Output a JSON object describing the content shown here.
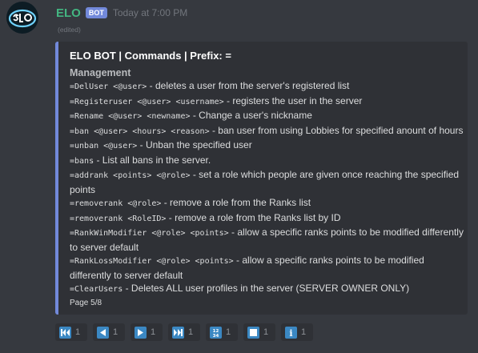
{
  "message": {
    "author": "ELO",
    "bot_tag": "BOT",
    "timestamp": "Today at 7:00 PM",
    "edited": "(edited)"
  },
  "embed": {
    "color": "#7289da",
    "title": "ELO BOT | Commands | Prefix: =",
    "field_name": "Management",
    "lines": [
      {
        "cmd": "=DelUser <@user>",
        "desc": " - deletes a user from the server's registered list"
      },
      {
        "cmd": "=Registeruser <@user> <username>",
        "desc": " - registers the user in the server"
      },
      {
        "cmd": "=Rename <@user> <newname>",
        "desc": " - Change a user's nickname"
      },
      {
        "cmd": "=ban <@user> <hours> <reason>",
        "desc": " - ban user from using Lobbies for specified anount of hours"
      },
      {
        "cmd": "=unban <@user>",
        "desc": " - Unban the specified user"
      },
      {
        "cmd": "=bans",
        "desc": " - List all bans in the server."
      },
      {
        "cmd": "=addrank <points> <@role>",
        "desc": " - set a role which people are given once reaching the specified points"
      },
      {
        "cmd": "=removerank <@role>",
        "desc": " - remove a role from the Ranks list"
      },
      {
        "cmd": "=removerank <RoleID>",
        "desc": " - remove a role from the Ranks list by ID"
      },
      {
        "cmd": "=RankWinModifier <@role> <points>",
        "desc": " - allow a specific ranks points to be modified differently to server default"
      },
      {
        "cmd": "=RankLossModifier <@role> <points>",
        "desc": " - allow a specific ranks points to be modified differently to server default"
      },
      {
        "cmd": "=ClearUsers",
        "desc": " - Deletes ALL user profiles in the server (SERVER OWNER ONLY)"
      }
    ],
    "footer": "Page 5/8"
  },
  "reactions": [
    {
      "icon": "track-previous-icon",
      "count": "1"
    },
    {
      "icon": "arrow-backward-icon",
      "count": "1"
    },
    {
      "icon": "arrow-forward-icon",
      "count": "1"
    },
    {
      "icon": "track-next-icon",
      "count": "1"
    },
    {
      "icon": "numbers-icon",
      "glyph": "1234",
      "count": "1"
    },
    {
      "icon": "stop-button-icon",
      "count": "1"
    },
    {
      "icon": "information-icon",
      "glyph": "i",
      "count": "1"
    }
  ]
}
